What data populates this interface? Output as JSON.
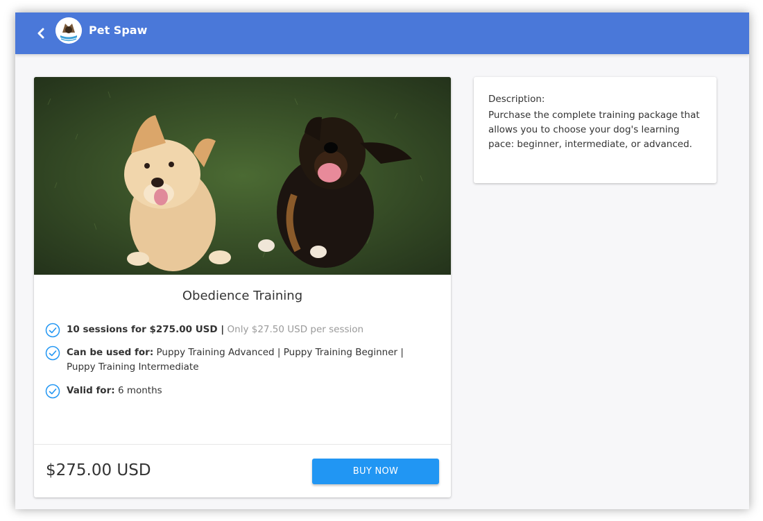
{
  "app": {
    "title": "Pet Spaw",
    "logo_icon": "pet-spaw-logo",
    "back_icon": "chevron-left-icon"
  },
  "colors": {
    "appbar": "#4a78d9",
    "buy_button": "#2196f3",
    "check": "#2196f3"
  },
  "product": {
    "image_icon": "two-dogs-photo",
    "title": "Obedience Training",
    "features": [
      {
        "icon": "check-circle-icon",
        "bold": "10 sessions for $275.00 USD |",
        "extra": " Only $27.50 USD per session"
      },
      {
        "icon": "check-circle-icon",
        "bold": "Can be used for:",
        "extra": " Puppy Training Advanced | Puppy Training Beginner | Puppy Training Intermediate"
      },
      {
        "icon": "check-circle-icon",
        "bold": "Valid for:",
        "extra": " 6 months"
      }
    ],
    "price": "$275.00 USD",
    "buy_label": "BUY NOW"
  },
  "description": {
    "label": "Description:",
    "text": "Purchase the complete training package that allows you to choose your dog's learning pace: beginner, intermediate, or advanced."
  }
}
